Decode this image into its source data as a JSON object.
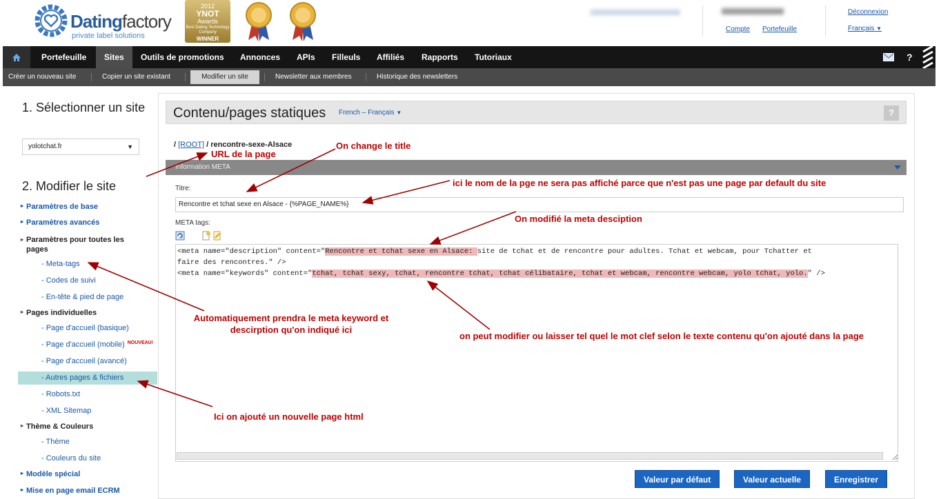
{
  "header": {
    "brand_main": "Dating",
    "brand_second": "factory",
    "brand_sub": "private label solutions",
    "award_year": "2012",
    "award_name": "YNOT",
    "award_line": "Awards",
    "award_desc": "Best Dating Technology Company",
    "award_winner": "WINNER",
    "links": {
      "deconnexion": "Déconnexion",
      "compte": "Compte",
      "portefeuille": "Portefeuille",
      "francais": "Français"
    }
  },
  "nav": {
    "items": [
      "Portefeuille",
      "Sites",
      "Outils de promotions",
      "Annonces",
      "APIs",
      "Filleuls",
      "Affiliés",
      "Rapports",
      "Tutoriaux"
    ],
    "active": "Sites"
  },
  "subnav": {
    "items": [
      "Créer un nouveau site",
      "Copier un site existant",
      "Modifier un site",
      "Newsletter aux membres",
      "Historique des newsletters"
    ],
    "active": "Modifier un site"
  },
  "sidebar": {
    "step1": "1. Sélectionner un site",
    "site_value": "yolotchat.fr",
    "step2": "2. Modifier le site",
    "items": [
      {
        "label": "Paramètres de base"
      },
      {
        "label": "Paramètres avancés"
      },
      {
        "label": "Paramètres pour toutes les pages"
      },
      {
        "label": "- Meta-tags"
      },
      {
        "label": "- Codes de suivi"
      },
      {
        "label": "- En-tête & pied de page"
      },
      {
        "label": "Pages individuelles"
      },
      {
        "label": "- Page d'accueil (basique)"
      },
      {
        "label": "- Page d'accueil (mobile)"
      },
      {
        "label": "- Page d'accueil (avancé)"
      },
      {
        "label": "- Autres pages & fichiers"
      },
      {
        "label": "- Robots.txt"
      },
      {
        "label": "- XML Sitemap"
      },
      {
        "label": "Thème & Couleurs"
      },
      {
        "label": "- Thème"
      },
      {
        "label": "- Couleurs du site"
      },
      {
        "label": "Modèle spécial"
      },
      {
        "label": "Mise en page email ECRM"
      }
    ],
    "new_badge": "NOUVEAU!"
  },
  "main": {
    "title": "Contenu/pages statiques",
    "language": "French – Français",
    "help": "?",
    "breadcrumb_sep": "/",
    "breadcrumb_root": "[ROOT]",
    "breadcrumb_current": "rencontre-sexe-Alsace",
    "meta_section": "Information META",
    "titre_label": "Titre:",
    "titre_value": "Rencontre et tchat sexe en Alsace - {%PAGE_NAME%}",
    "meta_label": "META tags:",
    "editor": {
      "l1_pre": "<meta name=\"description\" content=\"",
      "l1_hl": "Rencontre et tchat sexe en Alsace: ",
      "l1_post": " site de tchat et de rencontre pour adultes. Tchat et webcam, pour Tchatter et",
      "l2": "faire des rencontres.\" />",
      "l3_pre": "<meta name=\"keywords\" content=\"",
      "l3_hl": "tchat, tchat sexy, tchat, rencontre tchat, tchat célibataire, tchat et webcam, rencontre webcam, yolo tchat, yolo.",
      "l3_post": "\" />"
    },
    "buttons": {
      "default": "Valeur par défaut",
      "current": "Valeur actuelle",
      "save": "Enregistrer"
    }
  },
  "annotations": {
    "url": "URL de la page",
    "title": "On change le title",
    "page_name": "ici le nom de la pge ne sera pas affiché parce que n'est pas une page par default du site",
    "meta_desc": "On modifié la meta desciption",
    "auto_1": "Automatiquement prendra le meta keyword et",
    "auto_2": "descirption qu'on indiqué ici",
    "keywords": "on peut modifier ou laisser tel quel le mot clef selon le texte contenu qu'on ajouté dans la page",
    "new_page": "Ici on ajouté un nouvelle page html"
  },
  "colors": {
    "annotation": "#c00000",
    "nav_bg": "#151515",
    "subnav_bg": "#4a4a4a",
    "button": "#1a66c2",
    "highlight": "#f0b8b8",
    "sidebar_highlight": "#b4dedc"
  }
}
